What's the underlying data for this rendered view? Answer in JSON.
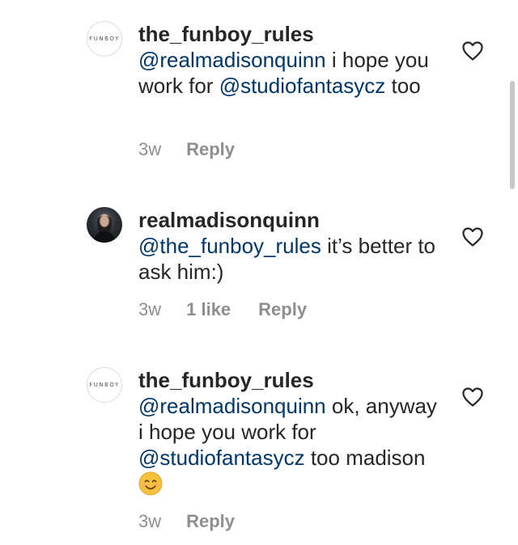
{
  "comments": [
    {
      "avatar_text": "FUNBOY",
      "username": "the_funboy_rules",
      "mention_1": "@realmadisonquinn",
      "text_1": " i hope you work for ",
      "mention_2": "@studiofantasycz",
      "text_2": " too",
      "time": "3w",
      "reply": "Reply"
    },
    {
      "username": "realmadisonquinn",
      "mention_1": "@the_funboy_rules",
      "text_1": " it’s better to ask him:)",
      "time": "3w",
      "likes": "1 like",
      "reply": "Reply"
    },
    {
      "avatar_text": "FUNBOY",
      "username": "the_funboy_rules",
      "mention_1": "@realmadisonquinn",
      "text_1": " ok, anyway i hope you work for ",
      "mention_2": "@studiofantasycz",
      "text_2": " too madison ",
      "emoji": "smiling-face-emoji",
      "time": "3w",
      "reply": "Reply"
    }
  ],
  "icons": {
    "like": "heart-outline-icon"
  },
  "colors": {
    "mention": "#00376b",
    "meta": "#8e8e8e",
    "text": "#262626"
  }
}
